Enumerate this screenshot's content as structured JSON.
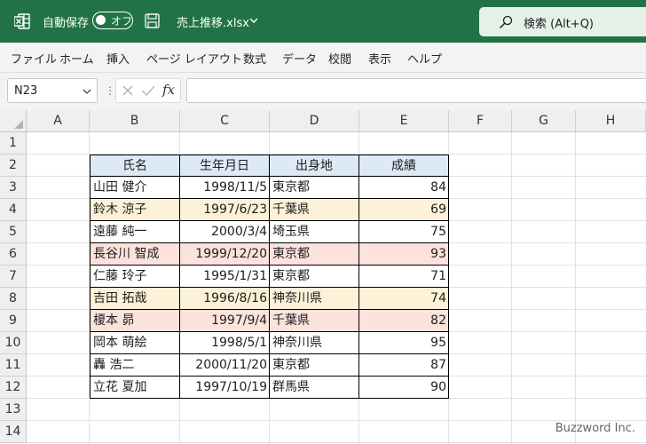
{
  "titlebar": {
    "autosave_label": "自動保存",
    "autosave_state": "オフ",
    "file_name": "売上推移.xlsx",
    "search_text": "検索 (Alt+Q)",
    "accent": "#217346"
  },
  "menu": [
    "ファイル",
    "ホーム",
    "挿入",
    "ページ レイアウト",
    "数式",
    "データ",
    "校閲",
    "表示",
    "ヘルプ"
  ],
  "formula_bar": {
    "name_box": "N23",
    "fx_label": "fx",
    "formula": ""
  },
  "columns": [
    "A",
    "B",
    "C",
    "D",
    "E",
    "F",
    "G",
    "H"
  ],
  "rows": [
    "1",
    "2",
    "3",
    "4",
    "5",
    "6",
    "7",
    "8",
    "9",
    "10",
    "11",
    "12",
    "13",
    "14"
  ],
  "table": {
    "headers": [
      "氏名",
      "生年月日",
      "出身地",
      "成績"
    ],
    "header_fill": "#dde9f5",
    "rows": [
      {
        "name": "山田 健介",
        "birth": "1998/11/5",
        "place": "東京都",
        "score": "84",
        "fill": ""
      },
      {
        "name": "鈴木 涼子",
        "birth": "1997/6/23",
        "place": "千葉県",
        "score": "69",
        "fill": "#fdf1d8"
      },
      {
        "name": "遠藤 純一",
        "birth": "2000/3/4",
        "place": "埼玉県",
        "score": "75",
        "fill": ""
      },
      {
        "name": "長谷川 智成",
        "birth": "1999/12/20",
        "place": "東京都",
        "score": "93",
        "fill": "#fbe2dc"
      },
      {
        "name": "仁藤 玲子",
        "birth": "1995/1/31",
        "place": "東京都",
        "score": "71",
        "fill": ""
      },
      {
        "name": "吉田 拓哉",
        "birth": "1996/8/16",
        "place": "神奈川県",
        "score": "74",
        "fill": "#fdf1d8"
      },
      {
        "name": "榎本 昴",
        "birth": "1997/9/4",
        "place": "千葉県",
        "score": "82",
        "fill": "#fbe2dc"
      },
      {
        "name": "岡本 萌絵",
        "birth": "1998/5/1",
        "place": "神奈川県",
        "score": "95",
        "fill": ""
      },
      {
        "name": "轟 浩二",
        "birth": "2000/11/20",
        "place": "東京都",
        "score": "87",
        "fill": ""
      },
      {
        "name": "立花 夏加",
        "birth": "1997/10/19",
        "place": "群馬県",
        "score": "90",
        "fill": ""
      }
    ]
  },
  "watermark": "Buzzword Inc."
}
